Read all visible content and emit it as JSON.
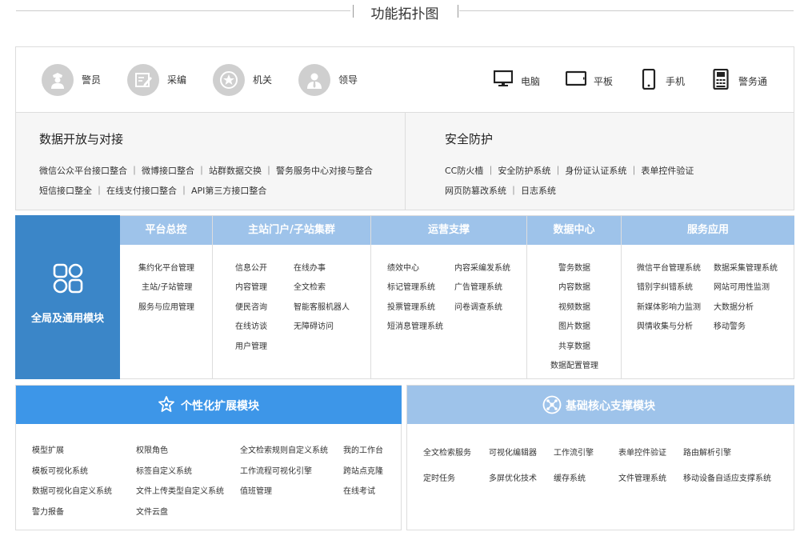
{
  "header": {
    "title": "功能拓扑图"
  },
  "users": [
    {
      "label": "警员",
      "icon": "police-officer-icon"
    },
    {
      "label": "采编",
      "icon": "editor-icon"
    },
    {
      "label": "机关",
      "icon": "emblem-icon"
    },
    {
      "label": "领导",
      "icon": "leader-icon"
    }
  ],
  "devices": [
    {
      "label": "电脑",
      "icon": "desktop-icon"
    },
    {
      "label": "平板",
      "icon": "tablet-icon"
    },
    {
      "label": "手机",
      "icon": "mobile-phone-icon"
    },
    {
      "label": "警务通",
      "icon": "police-terminal-icon"
    }
  ],
  "data_open": {
    "title": "数据开放与对接",
    "lines": [
      "微信公众平台接口整合 ｜ 微博接口整合 ｜ 站群数据交换 ｜ 警务服务中心对接与整合",
      "短信接口整全 ｜ 在线支付接口整合 ｜ API第三方接口整合"
    ]
  },
  "security": {
    "title": "安全防护",
    "lines": [
      "CC防火樯 ｜ 安全防护系统 ｜ 身份证认证系统 ｜ 表单控件验证",
      "网页防篡改系统 ｜ 日志系统"
    ]
  },
  "global_module": {
    "label": "全局及通用模块",
    "icon": "four-grid-icon"
  },
  "modules": [
    {
      "title": "平台总控",
      "columns": [
        [
          "集约化平台管理",
          "主站/子站管理",
          "服务与应用管理"
        ]
      ]
    },
    {
      "title": "主站门户/子站集群",
      "columns": [
        [
          "信息公开",
          "内容管理",
          "便民咨询",
          "在线访谈",
          "用户管理"
        ],
        [
          "在线办事",
          "全文检索",
          "智能客服机器人",
          "无障碍访问"
        ]
      ]
    },
    {
      "title": "运营支撑",
      "columns": [
        [
          "绩效中心",
          "标记管理系统",
          "投票管理系统",
          "短消息管理系统"
        ],
        [
          "内容采编发系统",
          "广告管理系统",
          "问卷调查系统"
        ]
      ]
    },
    {
      "title": "数据中心",
      "columns": [
        [
          "警务数据",
          "内容数据",
          "视频数据",
          "图片数据",
          "共享数据",
          "数据配置管理"
        ]
      ]
    },
    {
      "title": "服务应用",
      "columns": [
        [
          "微信平台管理系统",
          "错别字纠错系统",
          "新媒体影响力监测",
          "舆情收集与分析"
        ],
        [
          "数据采集管理系统",
          "网站可用性监测",
          "大数据分析",
          "移动警务"
        ]
      ]
    }
  ],
  "personalized": {
    "title": "个性化扩展模块",
    "icon": "puzzle-star-icon",
    "columns": [
      [
        "模型扩展",
        "模板可视化系统",
        "数据可视化自定义系统",
        "警力报备"
      ],
      [
        "权限角色",
        "标签自定义系统",
        "文件上传类型自定义系统",
        "文件云盘"
      ],
      [
        "全文检索规则自定义系统",
        "工作流程可视化引擎",
        "值班管理"
      ],
      [
        "我的工作台",
        "跨站点克隆",
        "在线考试"
      ]
    ]
  },
  "base_core": {
    "title": "基础核心支撑模块",
    "icon": "network-hub-icon",
    "rows": [
      [
        "全文检索服务",
        "可视化编辑器",
        "工作流引擎",
        "表单控件验证",
        "路由解析引擎"
      ],
      [
        "定时任务",
        "多屏优化技术",
        "缓存系统",
        "文件管理系统",
        "移动设备自适应支撑系统"
      ]
    ]
  },
  "colors": {
    "global_blue": "#3b86c8",
    "header_light_blue": "#9ec3ea",
    "personalized_blue": "#3d96e8",
    "gray_bg": "#f6f6f6",
    "icon_gray": "#cfcfcf"
  }
}
